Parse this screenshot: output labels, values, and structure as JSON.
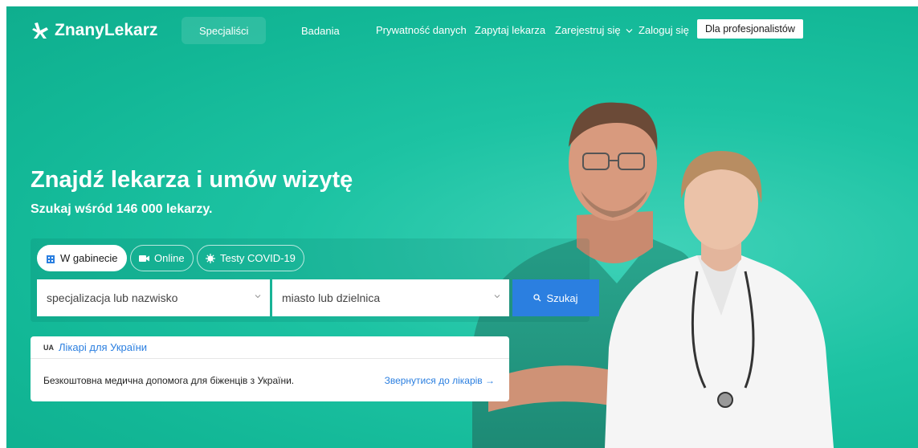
{
  "header": {
    "logo_text": "ZnanyLekarz",
    "nav_tabs": [
      {
        "label": "Specjaliści"
      },
      {
        "label": "Badania"
      }
    ],
    "links": {
      "privacy": "Prywatność danych",
      "ask": "Zapytaj lekarza",
      "register": "Zarejestruj się",
      "login": "Zaloguj się"
    },
    "pro_button": "Dla profesjonalistów"
  },
  "hero": {
    "title": "Znajdź lekarza i umów wizytę",
    "subtitle": "Szukaj wśród 146 000 lekarzy."
  },
  "search": {
    "modes": [
      {
        "label": "W gabinecie",
        "icon": "building-icon"
      },
      {
        "label": "Online",
        "icon": "video-camera-icon"
      },
      {
        "label": "Testy COVID-19",
        "icon": "virus-icon"
      }
    ],
    "specialization_placeholder": "specjalizacja lub nazwisko",
    "city_placeholder": "miasto lub dzielnica",
    "button_label": "Szukaj"
  },
  "ukraine": {
    "badge": "UA",
    "title": "Лікарі для України",
    "body": "Безкоштовна медична допомога для біженців з України.",
    "link": "Звернутися до лікарів →"
  },
  "colors": {
    "brand": "#13b896",
    "accent": "#2b7fe0"
  }
}
